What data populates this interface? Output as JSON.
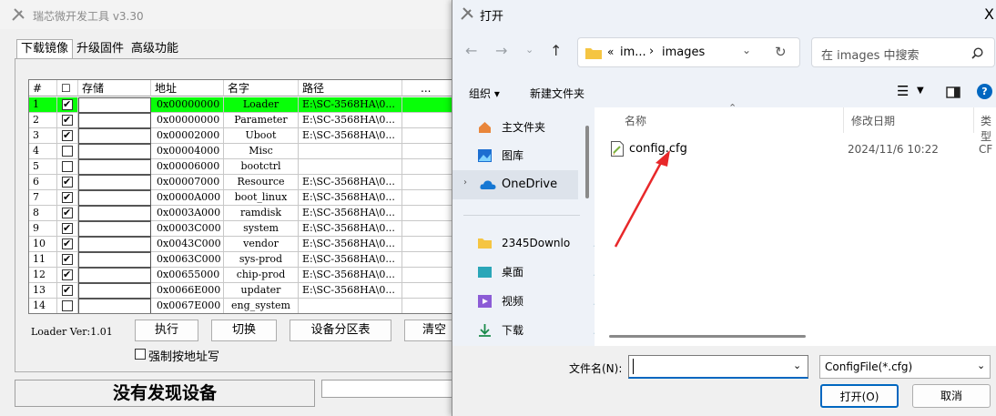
{
  "tool": {
    "title": "瑞芯微开发工具 v3.30",
    "tabs": [
      "下载镜像",
      "升级固件",
      "高级功能"
    ],
    "columns": [
      "#",
      "☐",
      "存储",
      "地址",
      "名字",
      "路径",
      "..."
    ],
    "rows": [
      {
        "num": "1",
        "checked": true,
        "addr": "0x00000000",
        "name": "Loader",
        "path": "E:\\SC-3568HA\\0...",
        "hl": true
      },
      {
        "num": "2",
        "checked": true,
        "addr": "0x00000000",
        "name": "Parameter",
        "path": "E:\\SC-3568HA\\0..."
      },
      {
        "num": "3",
        "checked": true,
        "addr": "0x00002000",
        "name": "Uboot",
        "path": "E:\\SC-3568HA\\0..."
      },
      {
        "num": "4",
        "checked": false,
        "addr": "0x00004000",
        "name": "Misc",
        "path": ""
      },
      {
        "num": "5",
        "checked": false,
        "addr": "0x00006000",
        "name": "bootctrl",
        "path": ""
      },
      {
        "num": "6",
        "checked": true,
        "addr": "0x00007000",
        "name": "Resource",
        "path": "E:\\SC-3568HA\\0..."
      },
      {
        "num": "7",
        "checked": true,
        "addr": "0x0000A000",
        "name": "boot_linux",
        "path": "E:\\SC-3568HA\\0..."
      },
      {
        "num": "8",
        "checked": true,
        "addr": "0x0003A000",
        "name": "ramdisk",
        "path": "E:\\SC-3568HA\\0..."
      },
      {
        "num": "9",
        "checked": true,
        "addr": "0x0003C000",
        "name": "system",
        "path": "E:\\SC-3568HA\\0..."
      },
      {
        "num": "10",
        "checked": true,
        "addr": "0x0043C000",
        "name": "vendor",
        "path": "E:\\SC-3568HA\\0..."
      },
      {
        "num": "11",
        "checked": true,
        "addr": "0x0063C000",
        "name": "sys-prod",
        "path": "E:\\SC-3568HA\\0..."
      },
      {
        "num": "12",
        "checked": true,
        "addr": "0x00655000",
        "name": "chip-prod",
        "path": "E:\\SC-3568HA\\0..."
      },
      {
        "num": "13",
        "checked": true,
        "addr": "0x0066E000",
        "name": "updater",
        "path": "E:\\SC-3568HA\\0..."
      },
      {
        "num": "14",
        "checked": false,
        "addr": "0x0067E000",
        "name": "eng_system",
        "path": ""
      }
    ],
    "loader_ver": "Loader Ver:1.01",
    "buttons": {
      "run": "执行",
      "switch": "切换",
      "partition": "设备分区表",
      "clear": "清空"
    },
    "force_addr": "强制按地址写",
    "status": "没有发现设备"
  },
  "dialog": {
    "title": "打开",
    "close": "X",
    "breadcrumb": {
      "overflow": "«",
      "seg1": "im...",
      "sep": "›",
      "seg2": "images"
    },
    "search_placeholder": "在 images 中搜索",
    "organize": "组织 ▾",
    "new_folder": "新建文件夹",
    "nav": {
      "home": "主文件夹",
      "gallery": "图库",
      "onedrive": "OneDrive",
      "downloads_folder": "2345Downlo",
      "desktop": "桌面",
      "videos": "视频",
      "downloads": "下载"
    },
    "columns": {
      "name": "名称",
      "modified": "修改日期",
      "type": "类型"
    },
    "file": {
      "name": "config.cfg",
      "date": "2024/11/6 10:22",
      "type": "CF"
    },
    "filename_label": "文件名(N):",
    "filename_value": "",
    "filter": "ConfigFile(*.cfg)",
    "open_btn": "打开(O)",
    "cancel_btn": "取消"
  },
  "colors": {
    "highlight": "#08ff08",
    "arrow": "#e8282a",
    "accent": "#0067c0"
  }
}
